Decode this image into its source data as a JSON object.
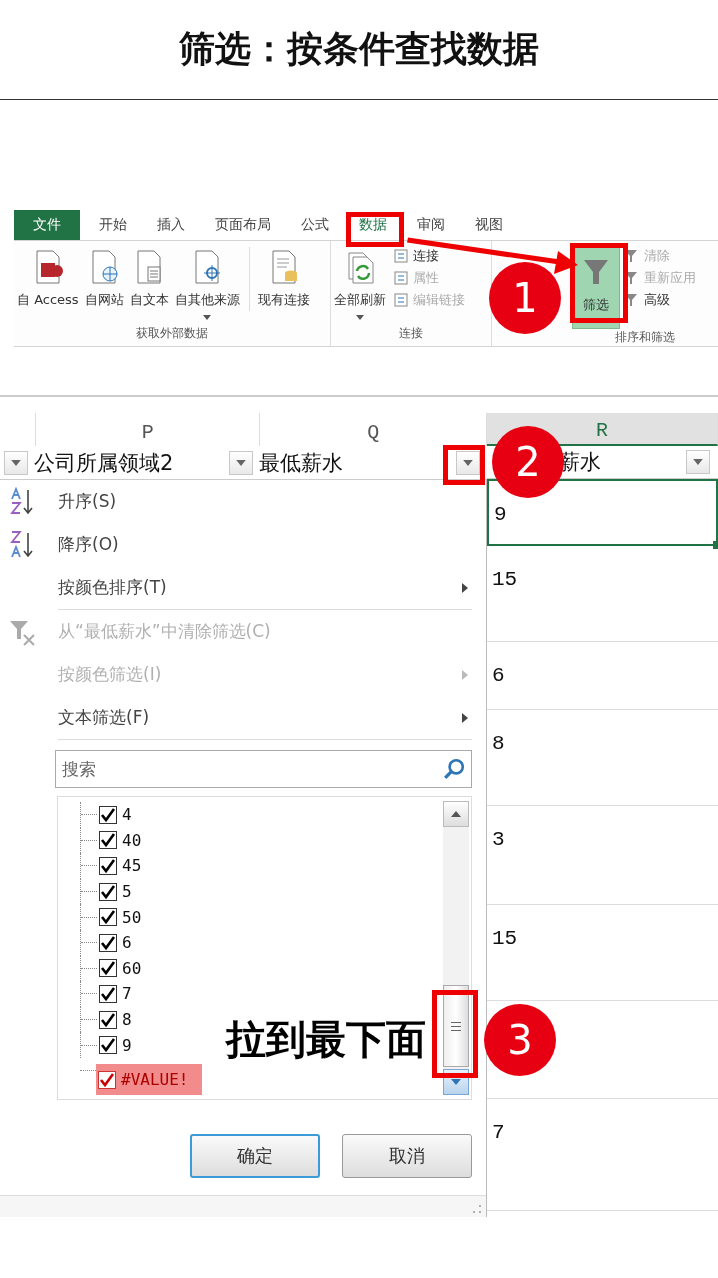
{
  "title": "筛选：按条件查找数据",
  "ribbon": {
    "tabs": [
      {
        "label": "文件",
        "kind": "file",
        "selected": false
      },
      {
        "label": "开始",
        "kind": "tab",
        "selected": false
      },
      {
        "label": "插入",
        "kind": "tab",
        "selected": false
      },
      {
        "label": "页面布局",
        "kind": "tab",
        "selected": false
      },
      {
        "label": "公式",
        "kind": "tab",
        "selected": false
      },
      {
        "label": "数据",
        "kind": "tab",
        "selected": true
      },
      {
        "label": "审阅",
        "kind": "tab",
        "selected": false
      },
      {
        "label": "视图",
        "kind": "tab",
        "selected": false
      }
    ],
    "groups": [
      {
        "label": "获取外部数据",
        "commands": [
          {
            "label": "自 Access",
            "kind": "large",
            "dropdown": false,
            "selected": false
          },
          {
            "label": "自网站",
            "kind": "large",
            "dropdown": false,
            "selected": false
          },
          {
            "label": "自文本",
            "kind": "large",
            "dropdown": false,
            "selected": false
          },
          {
            "label": "自其他来源",
            "kind": "large",
            "dropdown": true,
            "selected": false
          },
          {
            "label": "现有连接",
            "kind": "large",
            "dropdown": false,
            "selected": false
          }
        ]
      },
      {
        "label": "连接",
        "commands": [
          {
            "label": "全部刷新",
            "kind": "large",
            "dropdown": true,
            "selected": false
          },
          {
            "label": "连接",
            "kind": "small",
            "disabled": false
          },
          {
            "label": "属性",
            "kind": "small",
            "disabled": true
          },
          {
            "label": "编辑链接",
            "kind": "small",
            "disabled": true
          }
        ]
      },
      {
        "label": "排序和筛选",
        "commands": [
          {
            "label": "筛选",
            "kind": "large",
            "dropdown": false,
            "selected": true
          },
          {
            "label": "清除",
            "kind": "small",
            "disabled": true
          },
          {
            "label": "重新应用",
            "kind": "small",
            "disabled": true
          },
          {
            "label": "高级",
            "kind": "small",
            "disabled": false
          }
        ]
      }
    ]
  },
  "sheet": {
    "columns": [
      {
        "letter": "P",
        "selected": false
      },
      {
        "letter": "Q",
        "selected": false
      },
      {
        "letter": "R",
        "selected": true
      }
    ],
    "filter_headers": [
      "公司所属领域2",
      "最低薪水",
      "薪水"
    ],
    "menu": {
      "items": [
        {
          "kind": "sort_asc",
          "label": "升序(S)",
          "disabled": false,
          "submenu": false
        },
        {
          "kind": "sort_desc",
          "label": "降序(O)",
          "disabled": false,
          "submenu": false
        },
        {
          "kind": "plain",
          "label": "按颜色排序(T)",
          "disabled": false,
          "submenu": true
        },
        {
          "kind": "clear",
          "label": "从“最低薪水”中清除筛选(C)",
          "disabled": true,
          "submenu": false
        },
        {
          "kind": "plain",
          "label": "按颜色筛选(I)",
          "disabled": true,
          "submenu": true
        },
        {
          "kind": "plain",
          "label": "文本筛选(F)",
          "disabled": false,
          "submenu": true
        }
      ],
      "search": {
        "placeholder": "搜索"
      },
      "values": [
        {
          "label": "4",
          "checked": true,
          "highlighted": false
        },
        {
          "label": "40",
          "checked": true,
          "highlighted": false
        },
        {
          "label": "45",
          "checked": true,
          "highlighted": false
        },
        {
          "label": "5",
          "checked": true,
          "highlighted": false
        },
        {
          "label": "50",
          "checked": true,
          "highlighted": false
        },
        {
          "label": "6",
          "checked": true,
          "highlighted": false
        },
        {
          "label": "60",
          "checked": true,
          "highlighted": false
        },
        {
          "label": "7",
          "checked": true,
          "highlighted": false
        },
        {
          "label": "8",
          "checked": true,
          "highlighted": false
        },
        {
          "label": "9",
          "checked": true,
          "highlighted": false
        },
        {
          "label": "#VALUE!",
          "checked": true,
          "highlighted": true
        }
      ],
      "buttons": [
        "确定",
        "取消"
      ]
    },
    "r_cells": [
      {
        "value": "9",
        "selected": true
      },
      {
        "value": "15",
        "selected": false
      },
      {
        "value": "6",
        "selected": false
      },
      {
        "value": "8",
        "selected": false
      },
      {
        "value": "3",
        "selected": false
      },
      {
        "value": "15",
        "selected": false
      },
      {
        "selected": false
      },
      {
        "value": "7",
        "selected": false
      }
    ]
  },
  "annotations": [
    {
      "number": "1"
    },
    {
      "number": "2"
    },
    {
      "number": "3",
      "caption": "拉到最下面"
    }
  ]
}
